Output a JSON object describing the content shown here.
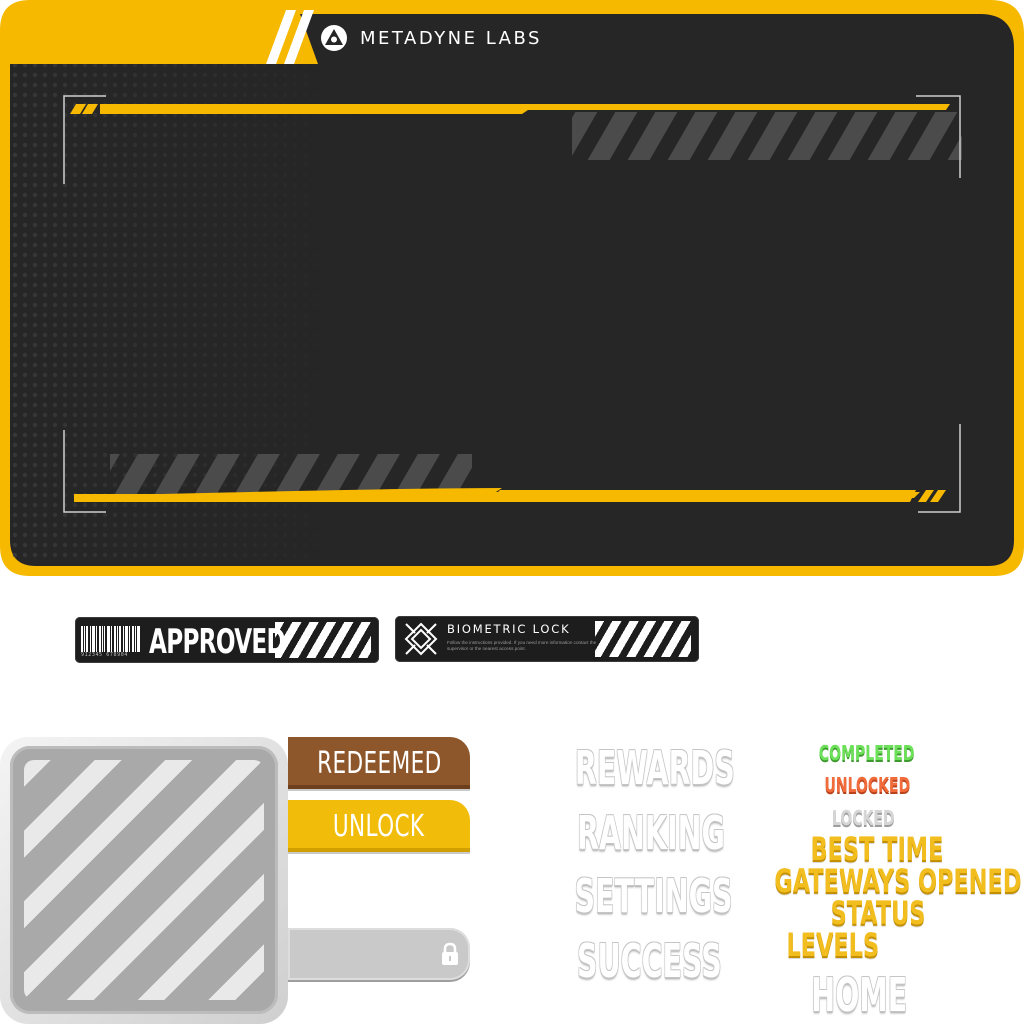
{
  "brand": {
    "name": "METADYNE LABS"
  },
  "badges": {
    "approved": {
      "barcode_number": "912345 678904",
      "label": "APPROVED"
    },
    "biometric": {
      "title": "BIOMETRIC LOCK",
      "description": "Follow the instructions provided. If you need more information contact the supervisor or the nearest access point."
    }
  },
  "buttons": {
    "redeemed": "REDEEMED",
    "unlock": "UNLOCK"
  },
  "menu_words": [
    "REWARDS",
    "RANKING",
    "SETTINGS",
    "SUCCESS"
  ],
  "status_words": {
    "completed": "COMPLETED",
    "unlocked": "UNLOCKED",
    "locked": "LOCKED",
    "best_time": "BEST TIME",
    "gateways_opened": "GATEWAYS OPENED",
    "status": "STATUS",
    "levels": "LEVELS",
    "home": "HOME"
  },
  "colors": {
    "accent_yellow": "#f2bd0a",
    "panel_dark": "#262626",
    "redeemed_brown": "#8d572b",
    "completed_green": "#6ee15b",
    "unlocked_orange": "#f26b3a"
  },
  "icons": {
    "brand": "tri-circle-logo-icon",
    "biometric": "fingerprint-crosshair-icon",
    "lock": "padlock-icon"
  }
}
